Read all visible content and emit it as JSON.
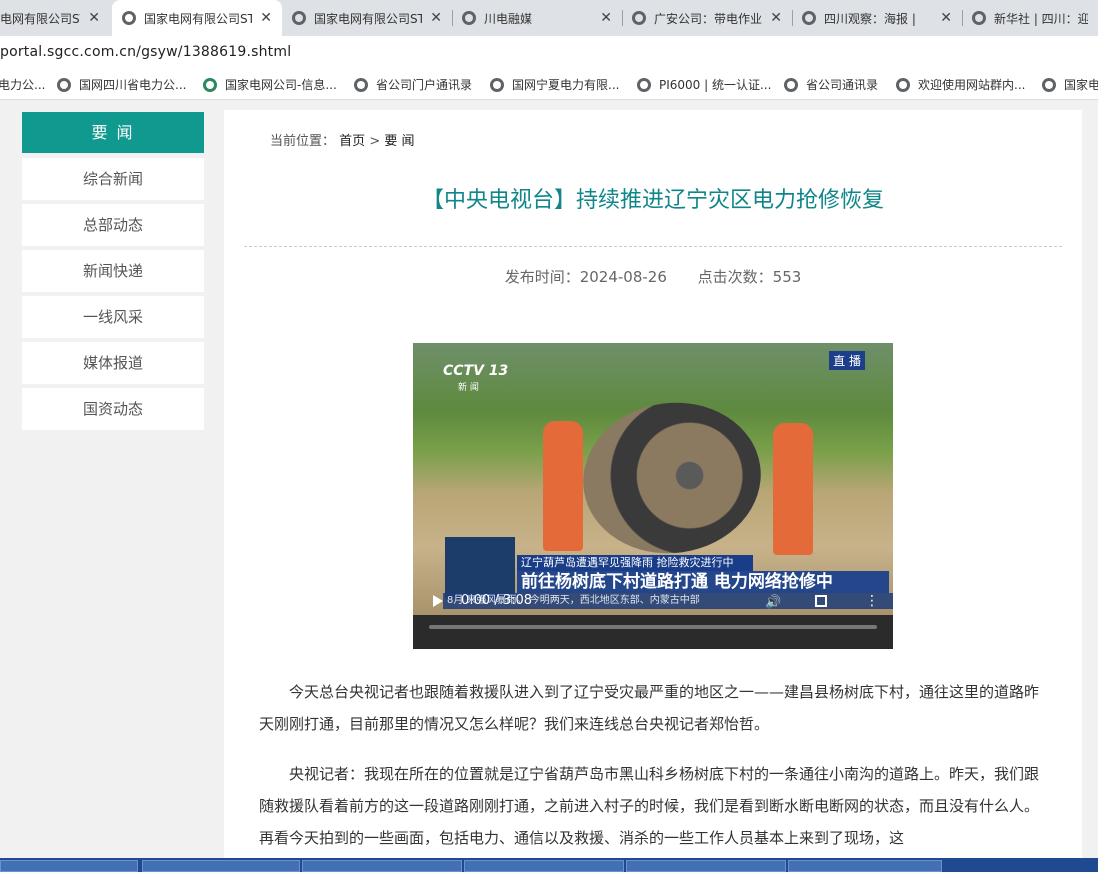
{
  "browser": {
    "tabs": [
      {
        "label": "电网有限公司ST",
        "active": false
      },
      {
        "label": "国家电网有限公司ST",
        "active": true
      },
      {
        "label": "国家电网有限公司ST",
        "active": false
      },
      {
        "label": "川电融媒",
        "active": false
      },
      {
        "label": "广安公司：带电作业",
        "active": false
      },
      {
        "label": "四川观察：海报 | ",
        "active": false
      },
      {
        "label": "新华社 | 四川：迎战",
        "active": false
      }
    ],
    "url": "portal.sgcc.com.cn/gsyw/1388619.shtml",
    "bookmarks": [
      "电力公...",
      "国网四川省电力公...",
      "国家电网公司-信息...",
      "省公司门户通讯录",
      "国网宁夏电力有限...",
      "PI6000 | 统一认证...",
      "省公司通讯录",
      "欢迎使用网站群内...",
      "国家电"
    ]
  },
  "sidebar": {
    "heading": "要 闻",
    "items": [
      "综合新闻",
      "总部动态",
      "新闻快递",
      "一线风采",
      "媒体报道",
      "国资动态"
    ]
  },
  "breadcrumb": {
    "prefix": "当前位置：",
    "home": "首页",
    "sep": ">",
    "current": "要 闻"
  },
  "article": {
    "title": "【中央电视台】持续推进辽宁灾区电力抢修恢复",
    "publish_label": "发布时间：2024-08-26",
    "clicks_label": "点击次数：553",
    "paragraphs": [
      "今天总台央视记者也跟随着救援队进入到了辽宁受灾最严重的地区之一——建昌县杨树底下村，通往这里的道路昨天刚刚打通，目前那里的情况又怎么样呢？我们来连线总台央视记者郑怡哲。",
      "央视记者：我现在所在的位置就是辽宁省葫芦岛市黑山科乡杨树底下村的一条通往小南沟的道路上。昨天，我们跟随救援队看着前方的这一段道路刚刚打通，之前进入村子的时候，我们是看到断水断电断网的状态，而且没有什么人。再看今天拍到的一些画面，包括电力、通信以及救援、消杀的一些工作人员基本上来到了现场，这"
    ]
  },
  "video": {
    "logo": "CCTV 13",
    "logo_sub": "新 闻",
    "live_badge": "直 播",
    "banner_top": "辽宁葫芦岛遭遇罕见强降雨 抢险救灾进行中",
    "banner_main": "前往杨树底下村道路打通 电力网络抢修中",
    "ticker": "8月 来强风暴雨。    今明两天，西北地区东部、内蒙古中部",
    "time": "0:00 / 3:08",
    "progress": 0
  }
}
